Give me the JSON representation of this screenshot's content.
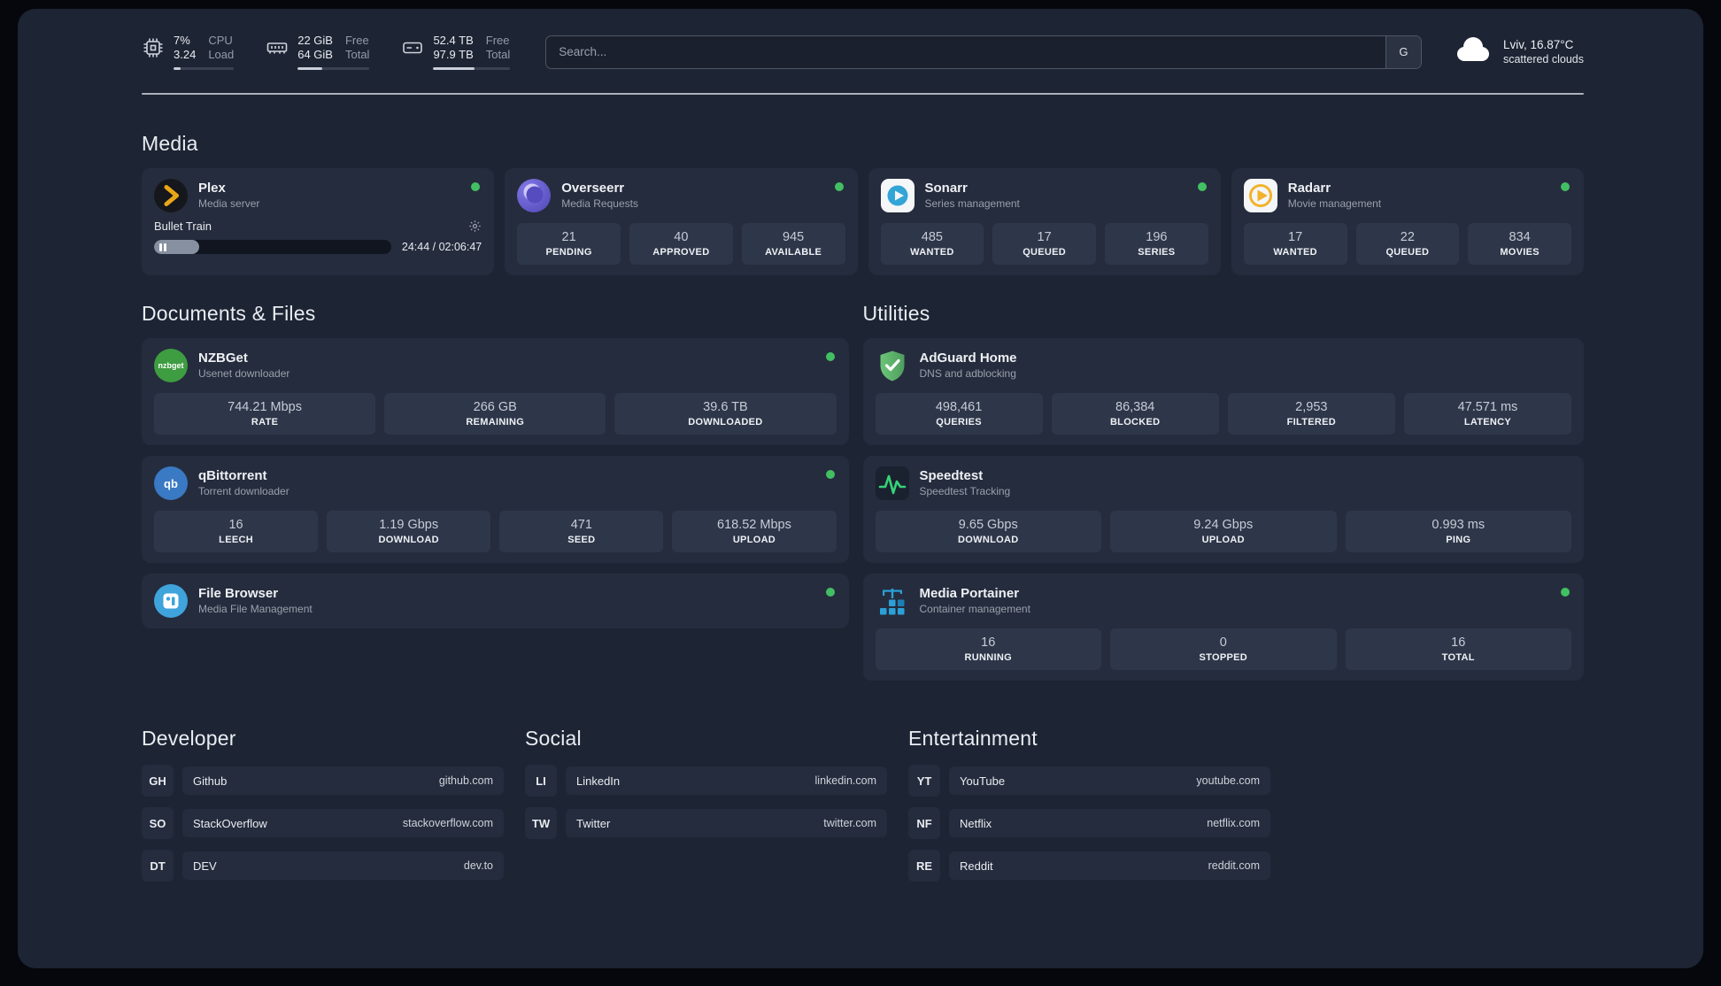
{
  "colors": {
    "background": "#1d2433",
    "card": "#252c3d",
    "stat_box": "#2e3649",
    "status_online": "#43bf63"
  },
  "topbar": {
    "cpu": {
      "icon": "cpu-icon",
      "percent": "7%",
      "load": "3.24",
      "label_top": "CPU",
      "label_bottom": "Load",
      "bar_percent": 12
    },
    "memory": {
      "icon": "memory-icon",
      "free": "22 GiB",
      "total": "64 GiB",
      "label_top": "Free",
      "label_bottom": "Total",
      "bar_percent": 34
    },
    "storage": {
      "icon": "storage-icon",
      "free": "52.4 TB",
      "total": "97.9 TB",
      "label_top": "Free",
      "label_bottom": "Total",
      "bar_percent": 54
    },
    "search": {
      "placeholder": "Search...",
      "engine_button": "G"
    },
    "weather": {
      "icon": "cloud-icon",
      "location": "Lviv, 16.87°C",
      "condition": "scattered clouds"
    }
  },
  "sections": {
    "media": "Media",
    "documents": "Documents & Files",
    "utilities": "Utilities",
    "developer": "Developer",
    "social": "Social",
    "entertainment": "Entertainment"
  },
  "apps": {
    "plex": {
      "name": "Plex",
      "description": "Media server",
      "icon": "plex-icon",
      "now_playing": {
        "title": "Bullet Train",
        "elapsed_total": "24:44 / 02:06:47",
        "progress_percent": 19
      }
    },
    "overseerr": {
      "name": "Overseerr",
      "description": "Media Requests",
      "icon": "overseerr-icon",
      "stats": [
        {
          "value": "21",
          "label": "PENDING"
        },
        {
          "value": "40",
          "label": "APPROVED"
        },
        {
          "value": "945",
          "label": "AVAILABLE"
        }
      ]
    },
    "sonarr": {
      "name": "Sonarr",
      "description": "Series management",
      "icon": "sonarr-icon",
      "stats": [
        {
          "value": "485",
          "label": "WANTED"
        },
        {
          "value": "17",
          "label": "QUEUED"
        },
        {
          "value": "196",
          "label": "SERIES"
        }
      ]
    },
    "radarr": {
      "name": "Radarr",
      "description": "Movie management",
      "icon": "radarr-icon",
      "stats": [
        {
          "value": "17",
          "label": "WANTED"
        },
        {
          "value": "22",
          "label": "QUEUED"
        },
        {
          "value": "834",
          "label": "MOVIES"
        }
      ]
    },
    "nzbget": {
      "name": "NZBGet",
      "description": "Usenet downloader",
      "icon": "nzbget-icon",
      "icon_text": "nzbget",
      "stats": [
        {
          "value": "744.21 Mbps",
          "label": "RATE"
        },
        {
          "value": "266 GB",
          "label": "REMAINING"
        },
        {
          "value": "39.6 TB",
          "label": "DOWNLOADED"
        }
      ]
    },
    "qbittorrent": {
      "name": "qBittorrent",
      "description": "Torrent downloader",
      "icon": "qbittorrent-icon",
      "icon_text": "qb",
      "stats": [
        {
          "value": "16",
          "label": "LEECH"
        },
        {
          "value": "1.19 Gbps",
          "label": "DOWNLOAD"
        },
        {
          "value": "471",
          "label": "SEED"
        },
        {
          "value": "618.52 Mbps",
          "label": "UPLOAD"
        }
      ]
    },
    "filebrowser": {
      "name": "File Browser",
      "description": "Media File Management",
      "icon": "filebrowser-icon"
    },
    "adguard": {
      "name": "AdGuard Home",
      "description": "DNS and adblocking",
      "icon": "adguard-icon",
      "stats": [
        {
          "value": "498,461",
          "label": "QUERIES"
        },
        {
          "value": "86,384",
          "label": "BLOCKED"
        },
        {
          "value": "2,953",
          "label": "FILTERED"
        },
        {
          "value": "47.571 ms",
          "label": "LATENCY"
        }
      ]
    },
    "speedtest": {
      "name": "Speedtest",
      "description": "Speedtest Tracking",
      "icon": "speedtest-icon",
      "stats": [
        {
          "value": "9.65 Gbps",
          "label": "DOWNLOAD"
        },
        {
          "value": "9.24 Gbps",
          "label": "UPLOAD"
        },
        {
          "value": "0.993 ms",
          "label": "PING"
        }
      ]
    },
    "portainer": {
      "name": "Media Portainer",
      "description": "Container management",
      "icon": "portainer-icon",
      "stats": [
        {
          "value": "16",
          "label": "RUNNING"
        },
        {
          "value": "0",
          "label": "STOPPED"
        },
        {
          "value": "16",
          "label": "TOTAL"
        }
      ]
    }
  },
  "links": {
    "developer": [
      {
        "abbr": "GH",
        "name": "Github",
        "url": "github.com"
      },
      {
        "abbr": "SO",
        "name": "StackOverflow",
        "url": "stackoverflow.com"
      },
      {
        "abbr": "DT",
        "name": "DEV",
        "url": "dev.to"
      }
    ],
    "social": [
      {
        "abbr": "LI",
        "name": "LinkedIn",
        "url": "linkedin.com"
      },
      {
        "abbr": "TW",
        "name": "Twitter",
        "url": "twitter.com"
      }
    ],
    "entertainment": [
      {
        "abbr": "YT",
        "name": "YouTube",
        "url": "youtube.com"
      },
      {
        "abbr": "NF",
        "name": "Netflix",
        "url": "netflix.com"
      },
      {
        "abbr": "RE",
        "name": "Reddit",
        "url": "reddit.com"
      }
    ]
  }
}
